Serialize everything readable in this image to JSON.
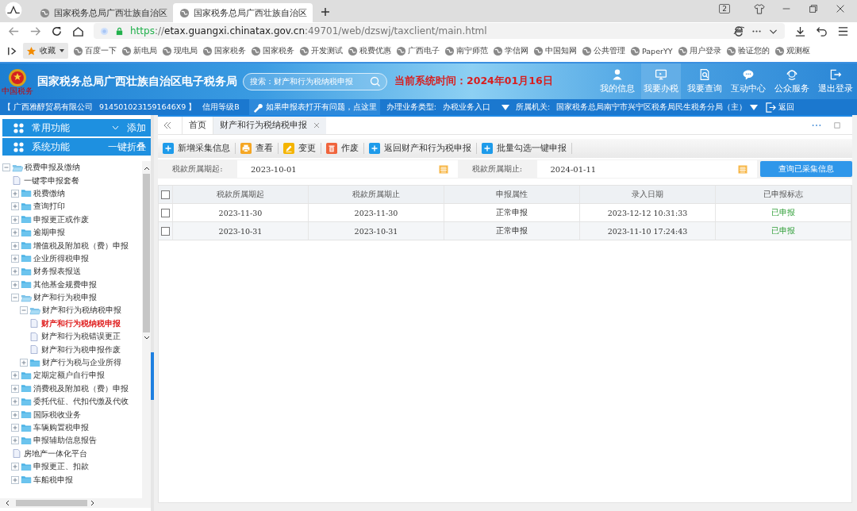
{
  "browser": {
    "tabs": [
      {
        "title": "国家税务总局广西壮族自治区",
        "selected": false
      },
      {
        "title": "国家税务总局广西壮族自治区",
        "selected": true
      }
    ],
    "tab_count": "2",
    "url": {
      "scheme": "https",
      "separator": "://",
      "host": "etax.guangxi.chinatax.gov.cn",
      "path": ":49701/web/dzswj/taxclient/main.html"
    },
    "favorites": "收藏",
    "bookmarks": [
      "百度一下",
      "新电局",
      "现电局",
      "国家税务",
      "国家税务",
      "开发测试",
      "税费优惠",
      "广西电子",
      "南宁师范",
      "学信网",
      "中国知网",
      "公共管理",
      "PaperYY",
      "用户登录",
      "验证您的",
      "观测枢"
    ]
  },
  "header": {
    "title": "国家税务总局广西壮族自治区电子税务局",
    "emblem_caption": "中国税务",
    "search": {
      "placeholder": "搜索：财产和行为税纳税申报"
    },
    "system_time": "当前系统时间：2024年01月16日",
    "nav": [
      {
        "label": "我的信息",
        "selected": false
      },
      {
        "label": "我要办税",
        "selected": true
      },
      {
        "label": "我要查询",
        "selected": false
      },
      {
        "label": "互动中心",
        "selected": false
      },
      {
        "label": "公众服务",
        "selected": false
      },
      {
        "label": "退出登录",
        "selected": false
      }
    ]
  },
  "info_bar": {
    "company": "【 广西雅醇贸易有限公司",
    "tax_id": "9145010231591646X9 】",
    "credit": "信用等级B",
    "help_link": "如果申报表打开有问题，点这里",
    "business_type_label": "办理业务类型:",
    "business_type": "办税业务入口",
    "authority_label": "所属机关:",
    "authority": "国家税务总局南宁市兴宁区税务局民生税务分局（主）",
    "back": "返回"
  },
  "sidebar": {
    "panels": [
      {
        "label": "常用功能",
        "action": "添加",
        "expanded": false
      },
      {
        "label": "系统功能",
        "action": "一键折叠",
        "expanded": true
      }
    ],
    "tree": [
      {
        "label": "税费申报及缴纳",
        "kind": "folder",
        "expanded": true,
        "selected": false,
        "children": [
          {
            "label": "一键零申报套餐",
            "kind": "file",
            "selected": false
          },
          {
            "label": "税费缴纳",
            "kind": "folder",
            "expanded": false,
            "selected": false
          },
          {
            "label": "查询打印",
            "kind": "folder",
            "expanded": false,
            "selected": false
          },
          {
            "label": "申报更正或作废",
            "kind": "folder",
            "expanded": false,
            "selected": false
          },
          {
            "label": "逾期申报",
            "kind": "folder",
            "expanded": false,
            "selected": false
          },
          {
            "label": "增值税及附加税（费）申报",
            "kind": "folder",
            "expanded": false,
            "selected": false
          },
          {
            "label": "企业所得税申报",
            "kind": "folder",
            "expanded": false,
            "selected": false
          },
          {
            "label": "财务报表报送",
            "kind": "folder",
            "expanded": false,
            "selected": false
          },
          {
            "label": "其他基金规费申报",
            "kind": "folder",
            "expanded": false,
            "selected": false
          },
          {
            "label": "财产和行为税申报",
            "kind": "folder",
            "expanded": true,
            "selected": false,
            "children": [
              {
                "label": "财产和行为税纳税申报",
                "kind": "folder",
                "expanded": true,
                "selected": false,
                "children": [
                  {
                    "label": "财产和行为税纳税申报",
                    "kind": "file",
                    "selected": true
                  },
                  {
                    "label": "财产和行为税错误更正",
                    "kind": "file",
                    "selected": false
                  },
                  {
                    "label": "财产和行为税申报作废",
                    "kind": "file",
                    "selected": false
                  }
                ]
              },
              {
                "label": "财产行为税与企业所得",
                "kind": "folder",
                "expanded": false,
                "selected": false
              }
            ]
          },
          {
            "label": "定期定额户自行申报",
            "kind": "folder",
            "expanded": false,
            "selected": false
          },
          {
            "label": "消费税及附加税（费）申报",
            "kind": "folder",
            "expanded": false,
            "selected": false
          },
          {
            "label": "委托代征、代扣代缴及代收",
            "kind": "folder",
            "expanded": false,
            "selected": false
          },
          {
            "label": "国际税收业务",
            "kind": "folder",
            "expanded": false,
            "selected": false
          },
          {
            "label": "车辆购置税申报",
            "kind": "folder",
            "expanded": false,
            "selected": false
          },
          {
            "label": "申报辅助信息报告",
            "kind": "folder",
            "expanded": false,
            "selected": false
          },
          {
            "label": "房地产一体化平台",
            "kind": "file",
            "selected": false
          },
          {
            "label": "申报更正、扣款",
            "kind": "folder",
            "expanded": false,
            "selected": false
          },
          {
            "label": "车船税申报",
            "kind": "folder",
            "expanded": false,
            "selected": false
          }
        ]
      }
    ]
  },
  "content": {
    "tabs": [
      {
        "label": "首页",
        "selected": false,
        "closable": false
      },
      {
        "label": "财产和行为税纳税申报",
        "selected": true,
        "closable": true
      }
    ],
    "toolbar": [
      {
        "label": "新增采集信息",
        "kind": "add"
      },
      {
        "label": "查看",
        "kind": "print"
      },
      {
        "label": "变更",
        "kind": "edit"
      },
      {
        "label": "作废",
        "kind": "delete"
      },
      {
        "label": "返回财产和行为税申报",
        "kind": "add"
      },
      {
        "label": "批量勾选一键申报",
        "kind": "add"
      }
    ],
    "filter": {
      "start_label": "税款所属期起:",
      "start": "2023-10-01",
      "end_label": "税款所属期止:",
      "end": "2024-01-11",
      "query_button": "查询已采集信息"
    },
    "table": {
      "select_all_checked": false,
      "columns": [
        "税款所属期起",
        "税款所属期止",
        "申报属性",
        "录入日期",
        "已申报标志"
      ],
      "rows": [
        {
          "checked": false,
          "cells": [
            "2023-11-30",
            "2023-11-30",
            "正常申报",
            "2023-12-12 10:31:33",
            "已申报"
          ]
        },
        {
          "checked": false,
          "cells": [
            "2023-10-31",
            "2023-10-31",
            "正常申报",
            "2023-11-10 17:24:43",
            "已申报"
          ]
        }
      ]
    }
  }
}
